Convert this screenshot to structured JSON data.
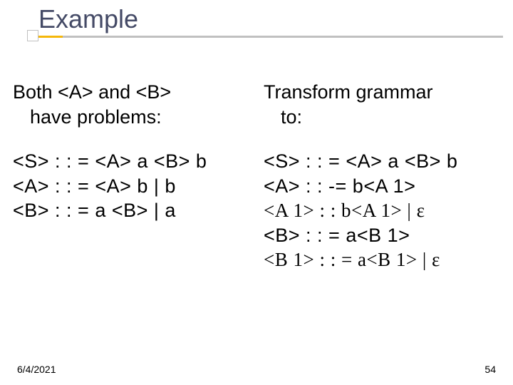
{
  "title": "Example",
  "left": {
    "intro_l1": "Both <A> and <B>",
    "intro_l2": "have problems:",
    "rules": [
      "<S> : : = <A> a <B> b",
      "<A> : : = <A> b | b",
      "<B> : : = a <B> | a"
    ]
  },
  "right": {
    "intro_l1": "Transform grammar",
    "intro_l2": "to:",
    "rules": [
      "<S> : : = <A> a <B> b",
      "<A> : : -= b<A 1>",
      "<A 1> : : b<A 1> |  ε",
      "<B> : : = a<B 1>",
      "<B 1> : : = a<B 1> |  ε"
    ]
  },
  "footer": {
    "date": "6/4/2021",
    "page": "54"
  }
}
